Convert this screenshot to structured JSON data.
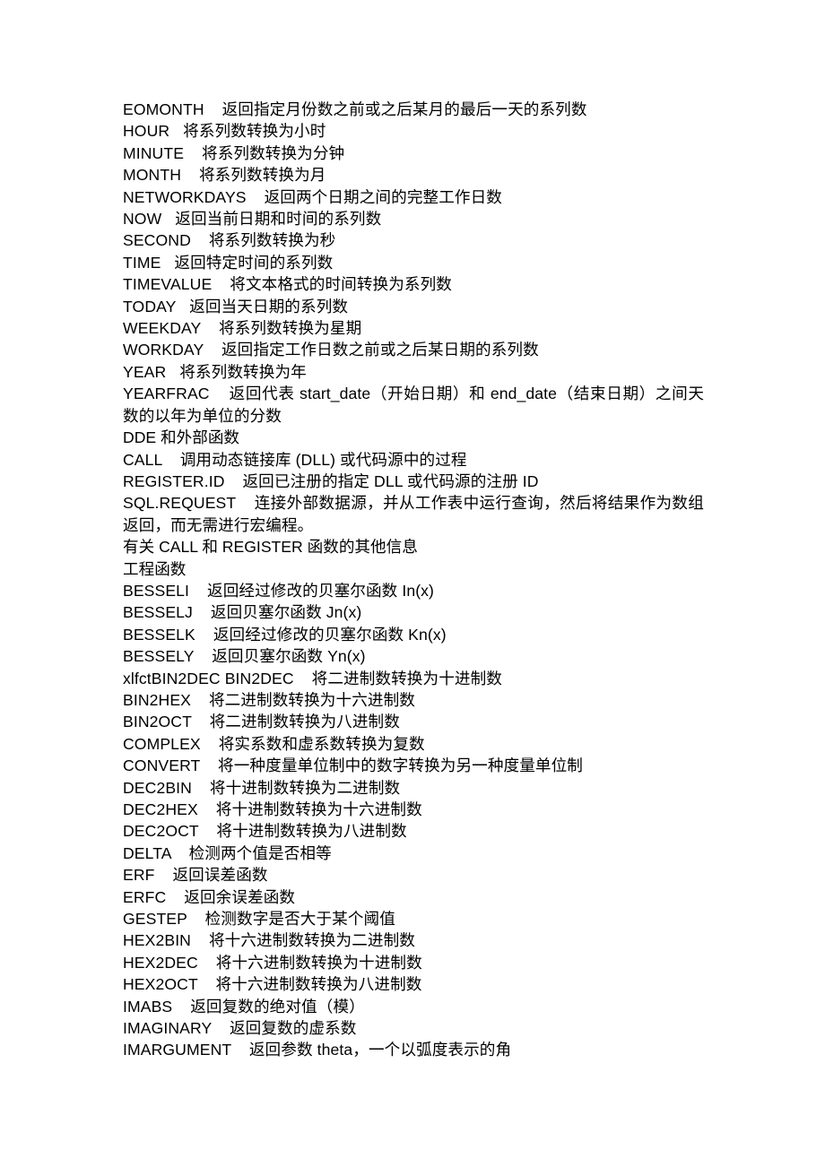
{
  "document": {
    "page_background": "#ffffff",
    "text_color": "#000000",
    "entries": [
      {
        "kind": "entry",
        "name": "EOMONTH",
        "gap": "    ",
        "desc": "返回指定月份数之前或之后某月的最后一天的系列数"
      },
      {
        "kind": "entry",
        "name": "HOUR",
        "gap": "   ",
        "desc": "将系列数转换为小时"
      },
      {
        "kind": "entry",
        "name": "MINUTE",
        "gap": "    ",
        "desc": "将系列数转换为分钟"
      },
      {
        "kind": "entry",
        "name": "MONTH",
        "gap": "    ",
        "desc": "将系列数转换为月"
      },
      {
        "kind": "entry",
        "name": "NETWORKDAYS",
        "gap": "    ",
        "desc": "返回两个日期之间的完整工作日数"
      },
      {
        "kind": "entry",
        "name": "NOW",
        "gap": "   ",
        "desc": "返回当前日期和时间的系列数"
      },
      {
        "kind": "entry",
        "name": "SECOND",
        "gap": "    ",
        "desc": "将系列数转换为秒"
      },
      {
        "kind": "entry",
        "name": "TIME",
        "gap": "   ",
        "desc": "返回特定时间的系列数"
      },
      {
        "kind": "entry",
        "name": "TIMEVALUE",
        "gap": "    ",
        "desc": "将文本格式的时间转换为系列数"
      },
      {
        "kind": "entry",
        "name": "TODAY",
        "gap": "   ",
        "desc": "返回当天日期的系列数"
      },
      {
        "kind": "entry",
        "name": "WEEKDAY",
        "gap": "    ",
        "desc": "将系列数转换为星期"
      },
      {
        "kind": "entry",
        "name": "WORKDAY",
        "gap": "    ",
        "desc": "返回指定工作日数之前或之后某日期的系列数"
      },
      {
        "kind": "entry",
        "name": "YEAR",
        "gap": "   ",
        "desc": "将系列数转换为年"
      },
      {
        "kind": "entry",
        "name": "YEARFRAC",
        "gap": "    ",
        "desc": "返回代表 start_date（开始日期）和 end_date（结束日期）之间天数的以年为单位的分数"
      },
      {
        "kind": "heading",
        "name": "",
        "gap": "",
        "desc": "DDE 和外部函数"
      },
      {
        "kind": "entry",
        "name": "CALL",
        "gap": "    ",
        "desc": "调用动态链接库 (DLL) 或代码源中的过程"
      },
      {
        "kind": "entry",
        "name": "REGISTER.ID",
        "gap": "    ",
        "desc": "返回已注册的指定 DLL 或代码源的注册 ID"
      },
      {
        "kind": "entry",
        "name": "SQL.REQUEST",
        "gap": "    ",
        "desc": "连接外部数据源，并从工作表中运行查询，然后将结果作为数组返回，而无需进行宏编程。"
      },
      {
        "kind": "heading",
        "name": "",
        "gap": "",
        "desc": "有关 CALL 和 REGISTER 函数的其他信息"
      },
      {
        "kind": "heading",
        "name": "",
        "gap": "",
        "desc": "工程函数"
      },
      {
        "kind": "entry",
        "name": "BESSELI",
        "gap": "    ",
        "desc": "返回经过修改的贝塞尔函数 In(x)"
      },
      {
        "kind": "entry",
        "name": "BESSELJ",
        "gap": "    ",
        "desc": "返回贝塞尔函数 Jn(x)"
      },
      {
        "kind": "entry",
        "name": "BESSELK",
        "gap": "    ",
        "desc": "返回经过修改的贝塞尔函数 Kn(x)"
      },
      {
        "kind": "entry",
        "name": "BESSELY",
        "gap": "    ",
        "desc": "返回贝塞尔函数 Yn(x)"
      },
      {
        "kind": "entry",
        "name": "xlfctBIN2DEC BIN2DEC",
        "gap": "    ",
        "desc": "将二进制数转换为十进制数"
      },
      {
        "kind": "entry",
        "name": "BIN2HEX",
        "gap": "    ",
        "desc": "将二进制数转换为十六进制数"
      },
      {
        "kind": "entry",
        "name": "BIN2OCT",
        "gap": "    ",
        "desc": "将二进制数转换为八进制数"
      },
      {
        "kind": "entry",
        "name": "COMPLEX",
        "gap": "    ",
        "desc": "将实系数和虚系数转换为复数"
      },
      {
        "kind": "entry",
        "name": "CONVERT",
        "gap": "    ",
        "desc": "将一种度量单位制中的数字转换为另一种度量单位制"
      },
      {
        "kind": "entry",
        "name": "DEC2BIN",
        "gap": "    ",
        "desc": "将十进制数转换为二进制数"
      },
      {
        "kind": "entry",
        "name": "DEC2HEX",
        "gap": "    ",
        "desc": "将十进制数转换为十六进制数"
      },
      {
        "kind": "entry",
        "name": "DEC2OCT",
        "gap": "    ",
        "desc": "将十进制数转换为八进制数"
      },
      {
        "kind": "entry",
        "name": "DELTA",
        "gap": "    ",
        "desc": "检测两个值是否相等"
      },
      {
        "kind": "entry",
        "name": "ERF",
        "gap": "    ",
        "desc": "返回误差函数"
      },
      {
        "kind": "entry",
        "name": "ERFC",
        "gap": "    ",
        "desc": "返回余误差函数"
      },
      {
        "kind": "entry",
        "name": "GESTEP",
        "gap": "    ",
        "desc": "检测数字是否大于某个阈值"
      },
      {
        "kind": "entry",
        "name": "HEX2BIN",
        "gap": "    ",
        "desc": "将十六进制数转换为二进制数"
      },
      {
        "kind": "entry",
        "name": "HEX2DEC",
        "gap": "    ",
        "desc": "将十六进制数转换为十进制数"
      },
      {
        "kind": "entry",
        "name": "HEX2OCT",
        "gap": "    ",
        "desc": "将十六进制数转换为八进制数"
      },
      {
        "kind": "entry",
        "name": "IMABS",
        "gap": "    ",
        "desc": "返回复数的绝对值（模）"
      },
      {
        "kind": "entry",
        "name": "IMAGINARY",
        "gap": "    ",
        "desc": "返回复数的虚系数"
      },
      {
        "kind": "entry",
        "name": "IMARGUMENT",
        "gap": "    ",
        "desc": "返回参数 theta，一个以弧度表示的角"
      }
    ]
  }
}
